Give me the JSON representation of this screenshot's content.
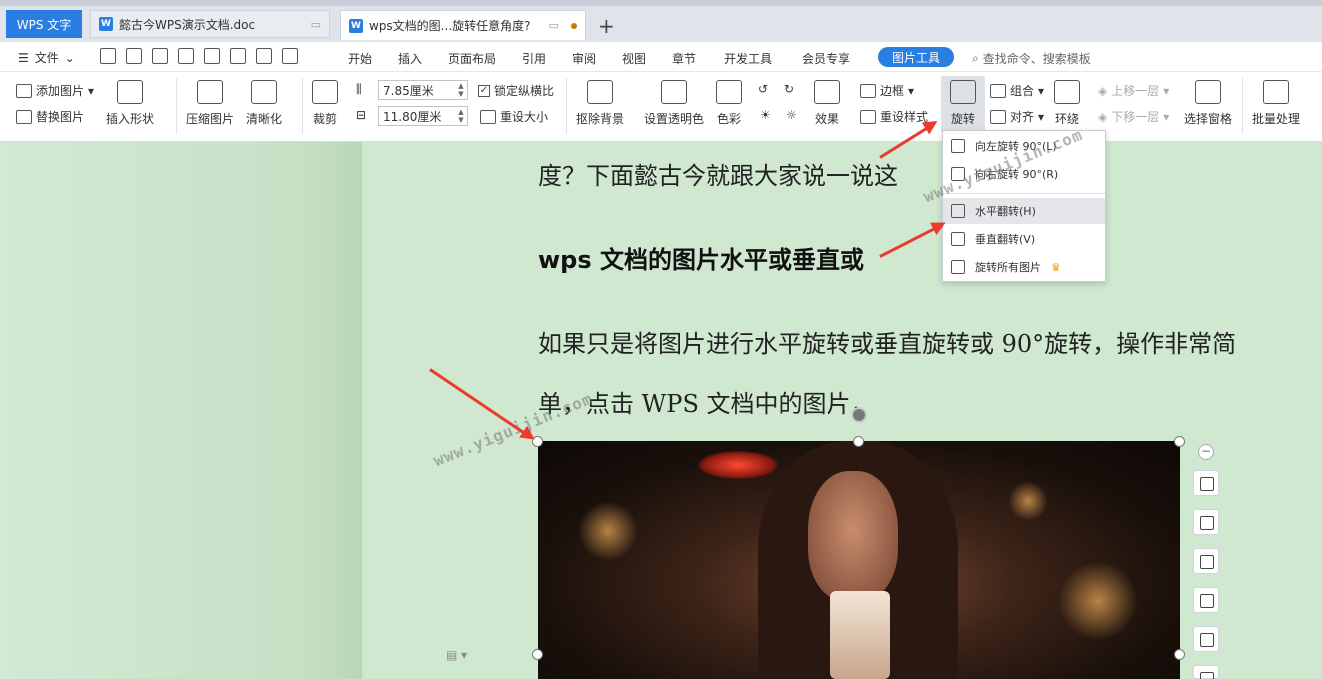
{
  "tabs": {
    "app": "WPS 文字",
    "doc1": "懿古今WPS演示文档.doc",
    "doc2": "wps文档的图...旋转任意角度?",
    "add": "+"
  },
  "menu": {
    "file": "文件",
    "items": [
      "开始",
      "插入",
      "页面布局",
      "引用",
      "审阅",
      "视图",
      "章节",
      "开发工具",
      "会员专享"
    ],
    "active": "图片工具",
    "search": "查找命令、搜索模板"
  },
  "ribbon": {
    "add_picture": "添加图片",
    "replace_picture": "替换图片",
    "insert_shape": "插入形状",
    "compress": "压缩图片",
    "sharpen": "清晰化",
    "crop": "裁剪",
    "height": "7.85厘米",
    "width": "11.80厘米",
    "lock_ratio": "锁定纵横比",
    "reset_size": "重设大小",
    "remove_bg": "抠除背景",
    "transparent": "设置透明色",
    "color": "色彩",
    "effects": "效果",
    "border": "边框",
    "reset_style": "重设样式",
    "rotate": "旋转",
    "group": "组合",
    "align": "对齐",
    "wrap": "环绕",
    "bring_forward": "上移一层",
    "send_backward": "下移一层",
    "select_pane": "选择窗格",
    "batch": "批量处理"
  },
  "rotate_menu": {
    "left90": "向左旋转 90°(L)",
    "right90": "向右旋转 90°(R)",
    "flip_h": "水平翻转(H)",
    "flip_v": "垂直翻转(V)",
    "rotate_all": "旋转所有图片"
  },
  "document": {
    "line1": "度？下面懿古今就跟大家说一说这",
    "heading": "wps 文档的图片水平或垂直或",
    "line2": "如果只是将图片进行水平旋转或垂直旋转或 90°旋转，操作非常简",
    "line3": "单，点击 WPS 文档中的图片，"
  },
  "watermark": "www.yiguijin.com",
  "colors": {
    "accent": "#2a7de1",
    "page_bg": "#cfe8cf",
    "arrow": "#ea3b2e"
  }
}
